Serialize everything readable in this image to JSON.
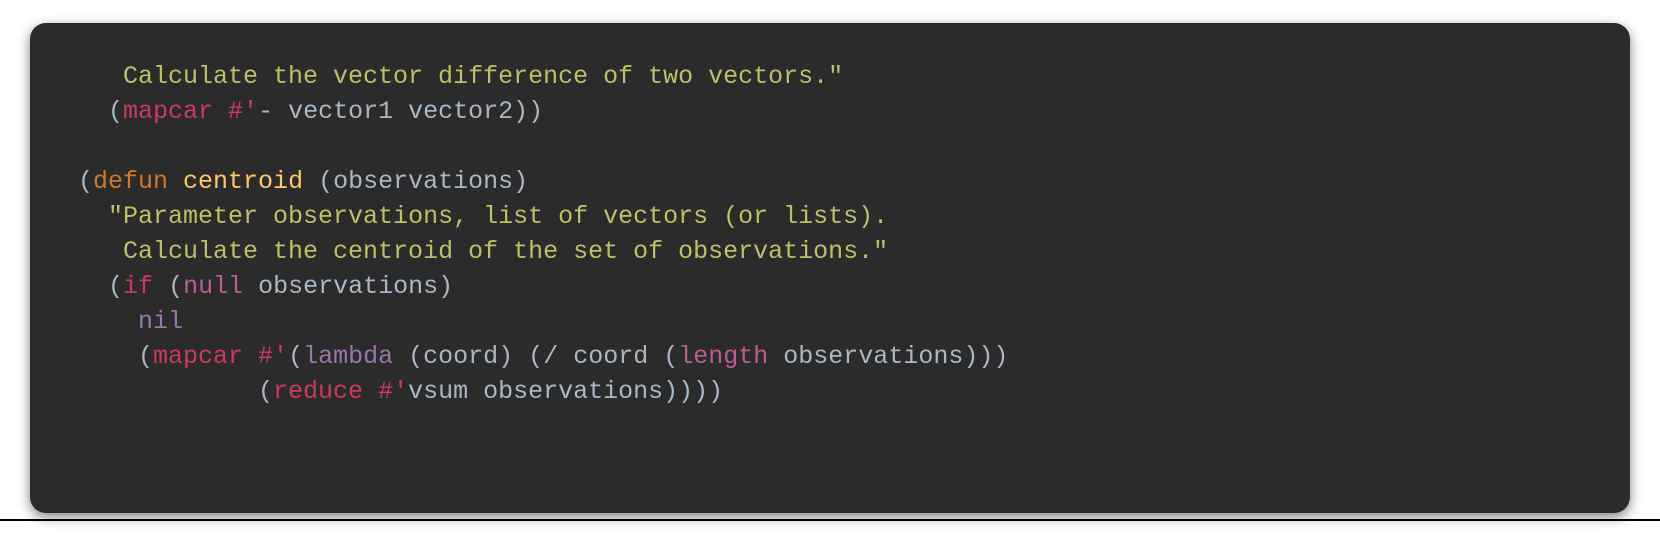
{
  "code": {
    "line1": {
      "text": "   Calculate the vector difference of two vectors.\""
    },
    "line2": {
      "lparen1": "(",
      "mapcar": "mapcar",
      "hashquote": " #'",
      "minus": "-",
      "args": " vector1 vector2",
      "rparens": "))"
    },
    "line3": "",
    "line4": {
      "lparen": "(",
      "defun": "defun",
      "space1": " ",
      "fname": "centroid",
      "space2": " ",
      "lparen2": "(",
      "param": "observations",
      "rparen": ")"
    },
    "line5": {
      "indent": "  ",
      "doc": "\"Parameter observations, list of vectors (or lists)."
    },
    "line6": {
      "indent": "   ",
      "doc": "Calculate the centroid of the set of observations.\""
    },
    "line7": {
      "indent": "  ",
      "lparen": "(",
      "if": "if",
      "space": " ",
      "lparen2": "(",
      "null": "null",
      "space2": " ",
      "obs": "observations",
      "rparen": ")"
    },
    "line8": {
      "indent": "    ",
      "nil": "nil"
    },
    "line9": {
      "indent": "    ",
      "lparen": "(",
      "mapcar": "mapcar",
      "hashquote": " #'",
      "lparen2": "(",
      "lambda": "lambda",
      "space": " ",
      "lparen3": "(",
      "coord": "coord",
      "rparen1": ")",
      "space2": " ",
      "lparen4": "(",
      "div": "/",
      "space3": " ",
      "coord2": "coord",
      "space4": " ",
      "lparen5": "(",
      "length": "length",
      "space5": " ",
      "obs": "observations",
      "rparens": ")))"
    },
    "line10": {
      "indent": "            ",
      "lparen": "(",
      "reduce": "reduce",
      "hashquote": " #'",
      "vsum": "vsum",
      "space": " ",
      "obs": "observations",
      "rparens": "))))"
    }
  }
}
